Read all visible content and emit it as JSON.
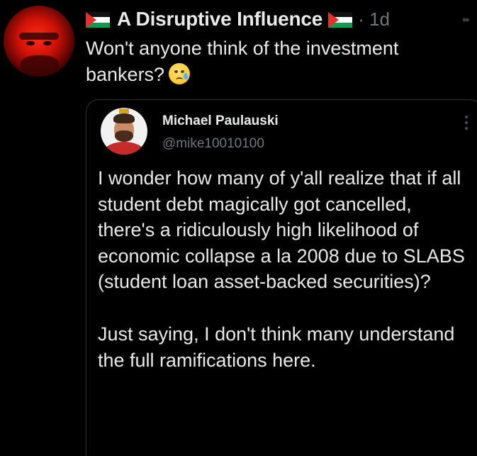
{
  "tweet": {
    "author_name": "A Disruptive Influence",
    "time": "· 1d",
    "text": "Won't anyone think of the investment bankers?",
    "flag_icon": "palestine-flag-icon",
    "emoji_icon": "crying-face-emoji",
    "more_icon": "more-dots-icon"
  },
  "quoted_tweet": {
    "author_name": "Michael Paulauski",
    "handle": "@mike10010100",
    "paragraph_1": "I wonder how many of y'all realize that if all student debt magically got cancelled, there's a ridiculously high likelihood of economic collapse a la 2008 due to SLABS (student loan asset-backed securities)?",
    "paragraph_2": "Just saying, I don't think many understand the full ramifications here.",
    "more_icon": "vertical-more-icon"
  },
  "colors": {
    "background": "#000000",
    "primary_text": "#e7e9ea",
    "secondary_text": "#71767b",
    "border": "#2f3336"
  }
}
